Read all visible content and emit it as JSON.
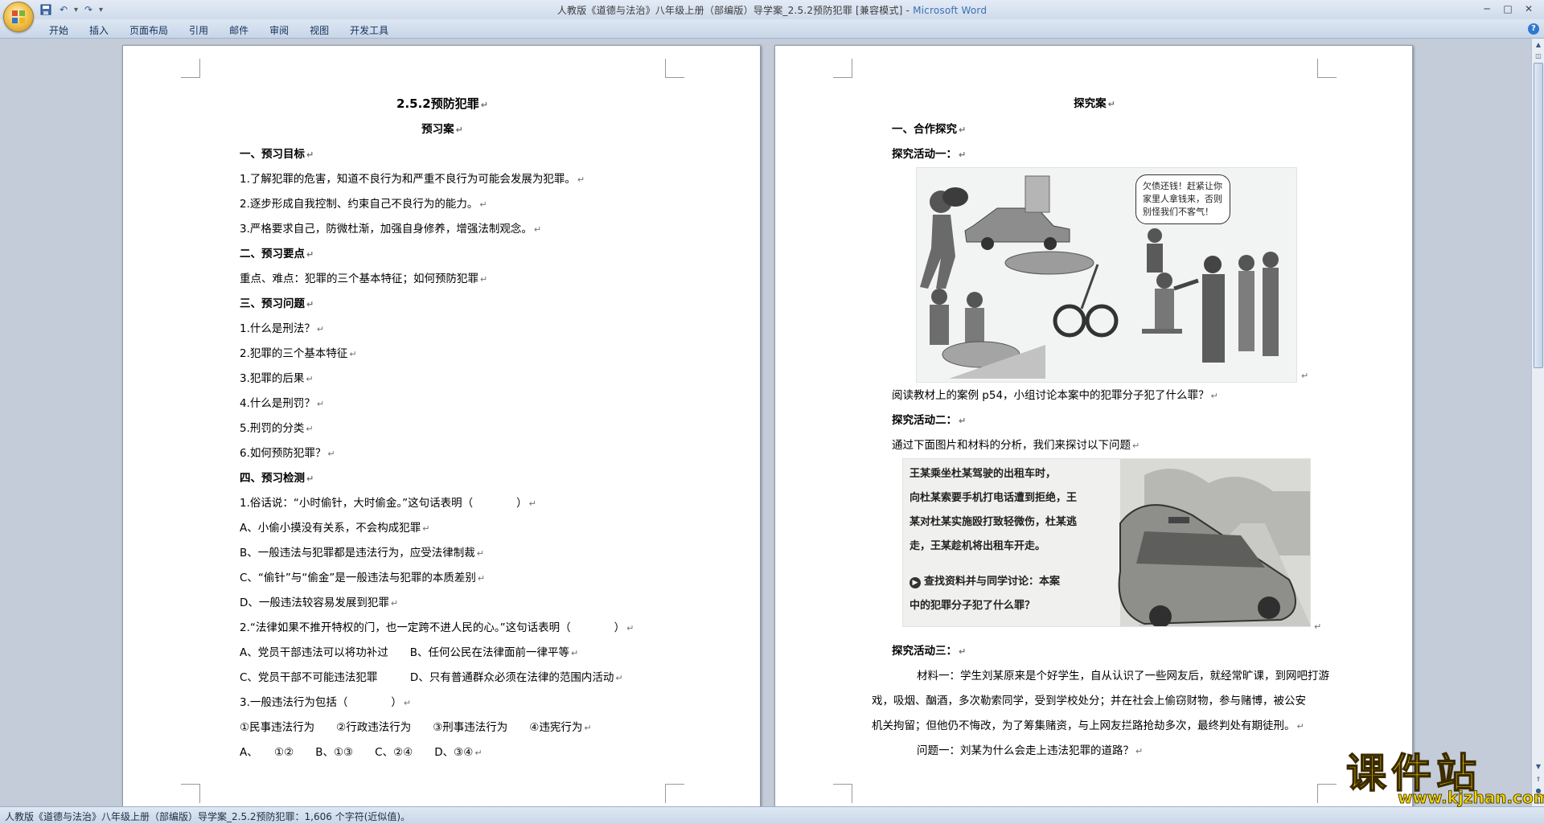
{
  "window": {
    "title": "人教版《道德与法治》八年级上册（部编版）导学案_2.5.2预防犯罪 [兼容模式] - ",
    "app_name": "Microsoft Word"
  },
  "quick_access": [
    "save-icon",
    "undo-icon",
    "redo-icon"
  ],
  "ribbon": {
    "tabs": [
      "开始",
      "插入",
      "页面布局",
      "引用",
      "邮件",
      "审阅",
      "视图",
      "开发工具"
    ]
  },
  "left_page": {
    "title": "2.5.2预防犯罪",
    "subtitle": "预习案",
    "lines": [
      {
        "text": "一、预习目标",
        "bold": true
      },
      {
        "text": "1.了解犯罪的危害，知道不良行为和严重不良行为可能会发展为犯罪。",
        "bold": false
      },
      {
        "text": "2.逐步形成自我控制、约束自己不良行为的能力。",
        "bold": false
      },
      {
        "text": "3.严格要求自己，防微杜渐，加强自身修养，增强法制观念。",
        "bold": false
      },
      {
        "text": "二、预习要点",
        "bold": true
      },
      {
        "text": "重点、难点：犯罪的三个基本特征；如何预防犯罪",
        "bold": false
      },
      {
        "text": "三、预习问题",
        "bold": true
      },
      {
        "text": "1.什么是刑法？",
        "bold": false
      },
      {
        "text": "2.犯罪的三个基本特征",
        "bold": false
      },
      {
        "text": "3.犯罪的后果",
        "bold": false
      },
      {
        "text": "4.什么是刑罚？",
        "bold": false
      },
      {
        "text": "5.刑罚的分类",
        "bold": false
      },
      {
        "text": "6.如何预防犯罪？",
        "bold": false
      },
      {
        "text": "四、预习检测",
        "bold": true
      },
      {
        "text": "1.俗话说：“小时偷针，大时偷金。”这句话表明（　　　　）",
        "bold": false
      },
      {
        "text": "A、小偷小摸没有关系，不会构成犯罪",
        "bold": false
      },
      {
        "text": "B、一般违法与犯罪都是违法行为，应受法律制裁",
        "bold": false
      },
      {
        "text": "C、“偷针”与“偷金”是一般违法与犯罪的本质差别",
        "bold": false
      },
      {
        "text": "D、一般违法较容易发展到犯罪",
        "bold": false
      },
      {
        "text": "2.“法律如果不推开特权的门，也一定跨不进人民的心。”这句话表明（　　　　）",
        "bold": false
      },
      {
        "text": "A、党员干部违法可以将功补过　　B、任何公民在法律面前一律平等",
        "bold": false
      },
      {
        "text": "C、党员干部不可能违法犯罪　　　D、只有普通群众必须在法律的范围内活动",
        "bold": false
      },
      {
        "text": "3.一般违法行为包括（　　　　）",
        "bold": false
      },
      {
        "text": "①民事违法行为　　②行政违法行为　　③刑事违法行为　　④违宪行为",
        "bold": false
      },
      {
        "text": "A、　　①②　　B、①③　　C、②④　　D、③④",
        "bold": false
      }
    ]
  },
  "right_page": {
    "title": "探究案",
    "section1": "一、合作探究",
    "activity1_label": "探究活动一：",
    "figure1": {
      "bubble_text": "欠债还钱！赶紧让你家里人拿钱来，否则别怪我们不客气！"
    },
    "activity1_question": "阅读教材上的案例 p54，小组讨论本案中的犯罪分子犯了什么罪？",
    "activity2_label": "探究活动二：",
    "activity2_intro": "通过下面图片和材料的分析，我们来探讨以下问题",
    "figure2": {
      "caption_lines": [
        "王某乘坐杜某驾驶的出租车时，",
        "向杜某索要手机打电话遭到拒绝，王",
        "某对杜某实施殴打致轻微伤，杜某逃",
        "走，王某趁机将出租车开走。"
      ],
      "prompt_lines": [
        "查找资料并与同学讨论：本案",
        "中的犯罪分子犯了什么罪？"
      ]
    },
    "activity3_label": "探究活动三：",
    "material_lines": [
      "材料一：学生刘某原来是个好学生，自从认识了一些网友后，就经常旷课，到网吧打游",
      "戏，吸烟、酗酒，多次勒索同学，受到学校处分；并在社会上偷窃财物，参与赌博，被公安",
      "机关拘留；但他仍不悔改，为了筹集赌资，与上网友拦路抢劫多次，最终判处有期徒刑。"
    ],
    "question1": "问题一：刘某为什么会走上违法犯罪的道路？"
  },
  "status_bar": {
    "text": "人教版《道德与法治》八年级上册（部编版）导学案_2.5.2预防犯罪：1,606 个字符(近似值)。"
  },
  "watermark": {
    "text": "课件站",
    "url": "www.kjzhan.com"
  }
}
